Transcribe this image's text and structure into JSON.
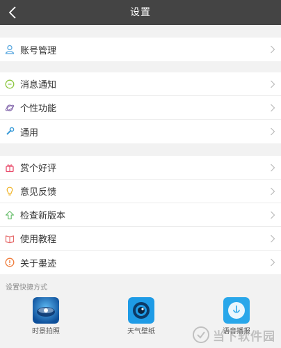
{
  "header": {
    "title": "设置"
  },
  "groups": {
    "account": {
      "items": [
        {
          "label": "账号管理",
          "icon": "user-icon"
        }
      ]
    },
    "features": {
      "items": [
        {
          "label": "消息通知",
          "icon": "message-icon"
        },
        {
          "label": "个性功能",
          "icon": "planet-icon"
        },
        {
          "label": "通用",
          "icon": "wrench-icon"
        }
      ]
    },
    "about": {
      "items": [
        {
          "label": "赏个好评",
          "icon": "gift-icon"
        },
        {
          "label": "意见反馈",
          "icon": "lightbulb-icon"
        },
        {
          "label": "检查新版本",
          "icon": "upgrade-icon"
        },
        {
          "label": "使用教程",
          "icon": "book-icon"
        },
        {
          "label": "关于墨迹",
          "icon": "info-icon"
        }
      ]
    }
  },
  "shortcuts": {
    "title": "设置快捷方式",
    "items": [
      {
        "label": "时景拍照",
        "icon": "camera-app-icon"
      },
      {
        "label": "天气壁纸",
        "icon": "wallpaper-app-icon"
      },
      {
        "label": "语音播报",
        "icon": "voice-app-icon"
      }
    ]
  },
  "watermark": {
    "text": "当下软件园"
  },
  "colors": {
    "header_bg": "#444444",
    "user": "#5aa8e0",
    "message": "#8cc63f",
    "planet": "#8a6fb0",
    "wrench": "#3a9bd8",
    "gift": "#e94b6b",
    "lightbulb": "#f0b429",
    "upgrade": "#6cc070",
    "book": "#e66a6a",
    "info": "#ef7b3a"
  }
}
